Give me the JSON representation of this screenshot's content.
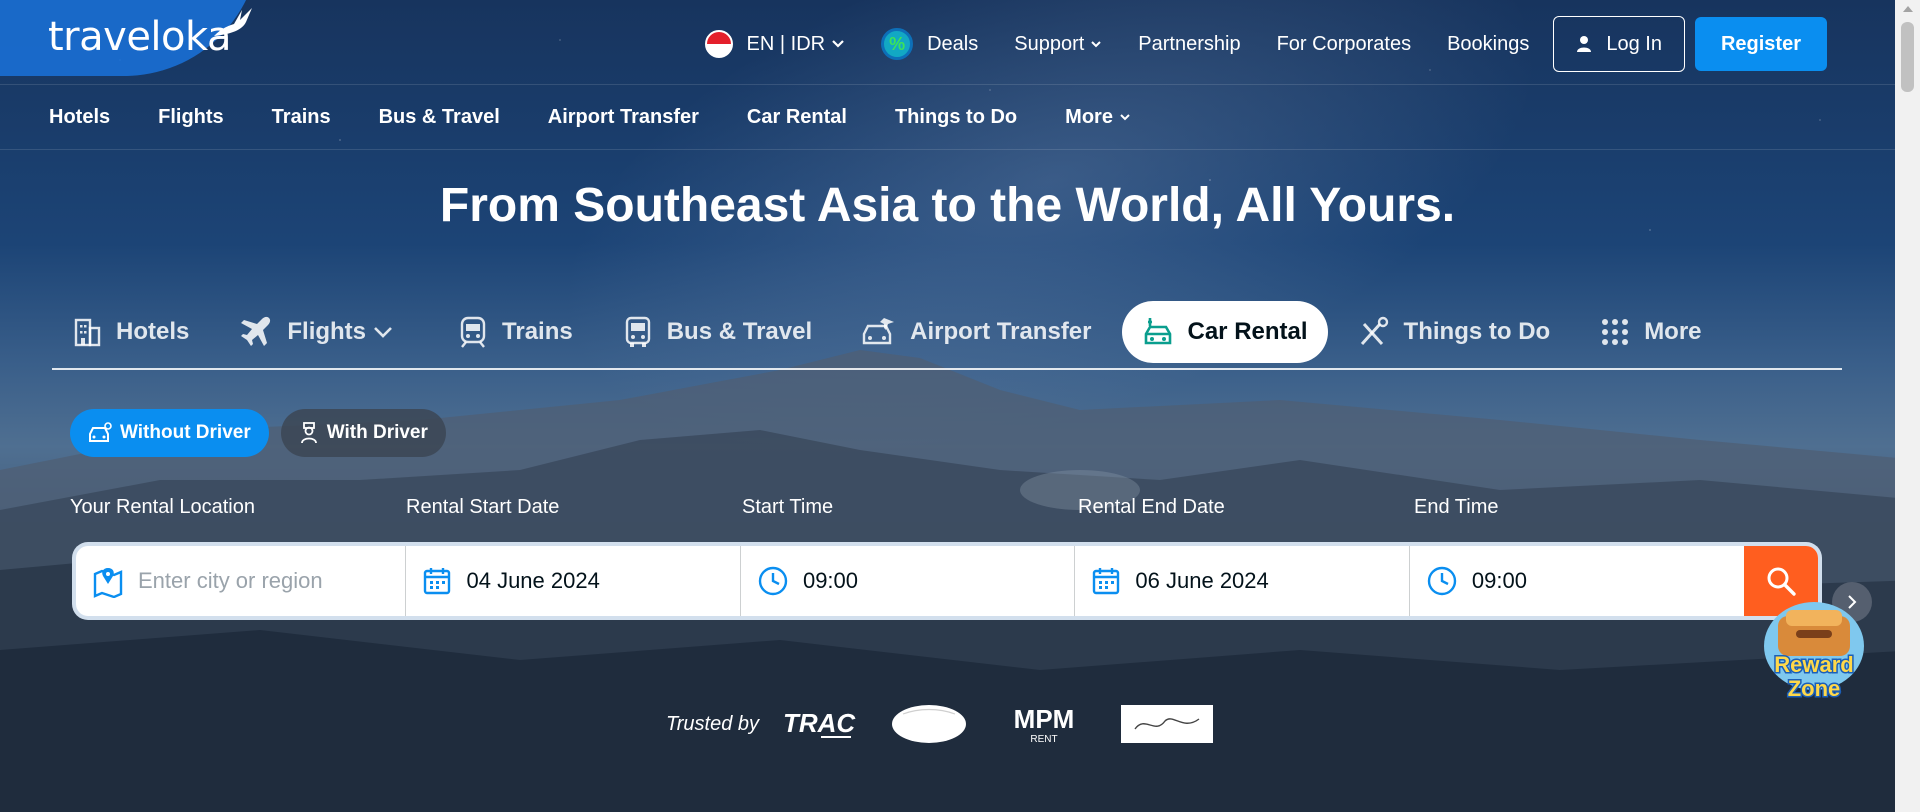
{
  "brand": {
    "name": "traveloka"
  },
  "top_nav": {
    "locale": "EN | IDR",
    "deals": "Deals",
    "support": "Support",
    "partnership": "Partnership",
    "corporates": "For Corporates",
    "bookings": "Bookings",
    "login": "Log In",
    "register": "Register"
  },
  "sub_nav": [
    "Hotels",
    "Flights",
    "Trains",
    "Bus & Travel",
    "Airport Transfer",
    "Car Rental",
    "Things to Do",
    "More"
  ],
  "headline": "From Southeast Asia to the World, All Yours.",
  "product_tabs": [
    {
      "label": "Hotels",
      "icon": "hotel-icon"
    },
    {
      "label": "Flights",
      "icon": "plane-icon"
    },
    {
      "label": "Trains",
      "icon": "train-icon"
    },
    {
      "label": "Bus & Travel",
      "icon": "bus-icon"
    },
    {
      "label": "Airport Transfer",
      "icon": "airport-transfer-icon"
    },
    {
      "label": "Car Rental",
      "icon": "car-icon",
      "active": true
    },
    {
      "label": "Things to Do",
      "icon": "activities-icon"
    },
    {
      "label": "More",
      "icon": "grid-icon"
    }
  ],
  "driver_options": {
    "without": "Without Driver",
    "with": "With Driver",
    "selected": "Without Driver"
  },
  "search": {
    "labels": {
      "location": "Your Rental Location",
      "start_date": "Rental Start Date",
      "start_time": "Start Time",
      "end_date": "Rental End Date",
      "end_time": "End Time"
    },
    "location_placeholder": "Enter city or region",
    "location_value": "",
    "start_date": "04 June 2024",
    "start_time": "09:00",
    "end_date": "06 June 2024",
    "end_time": "09:00"
  },
  "reward": {
    "line1": "Reward",
    "line2": "Zone"
  },
  "trusted": {
    "label": "Trusted by",
    "partners": [
      "TRAC",
      "MPM"
    ],
    "mpm_sub": "RENT"
  },
  "colors": {
    "primary": "#0a8ef0",
    "search": "#ff5e1f",
    "text_dark": "#03121a"
  }
}
